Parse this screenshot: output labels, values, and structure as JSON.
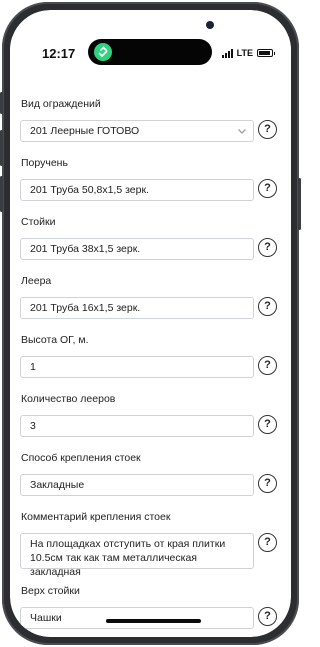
{
  "status": {
    "time": "12:17",
    "network": "LTE"
  },
  "colors": {
    "accent_logo": "#3ddc84",
    "frame": "#2b2d31"
  },
  "form": {
    "fields": [
      {
        "label": "Вид ограждений",
        "value": "201 Леерные ГОТОВО",
        "type": "select"
      },
      {
        "label": "Поручень",
        "value": "201 Труба 50,8х1,5 зерк.",
        "type": "text"
      },
      {
        "label": "Стойки",
        "value": "201 Труба 38х1,5 зерк.",
        "type": "text"
      },
      {
        "label": "Леера",
        "value": "201 Труба 16х1,5 зерк.",
        "type": "text"
      },
      {
        "label": "Высота ОГ, м.",
        "value": "1",
        "type": "text"
      },
      {
        "label": "Количество лееров",
        "value": "3",
        "type": "text"
      },
      {
        "label": "Способ крепления стоек",
        "value": "Закладные",
        "type": "text"
      },
      {
        "label": "Комментарий крепления стоек",
        "value_line1": "На площадках отступить от края плитки",
        "value_line2": "10.5см так как там металлическая закладная",
        "type": "textarea"
      },
      {
        "label": "Верх стойки",
        "value": "Чашки",
        "type": "text"
      }
    ],
    "help_symbol": "?"
  },
  "icons": {
    "status_logo": "link-logo-icon",
    "signal": "signal-bars-icon",
    "battery": "battery-icon",
    "select_arrow": "chevron-down-icon",
    "help": "question-mark-icon"
  }
}
